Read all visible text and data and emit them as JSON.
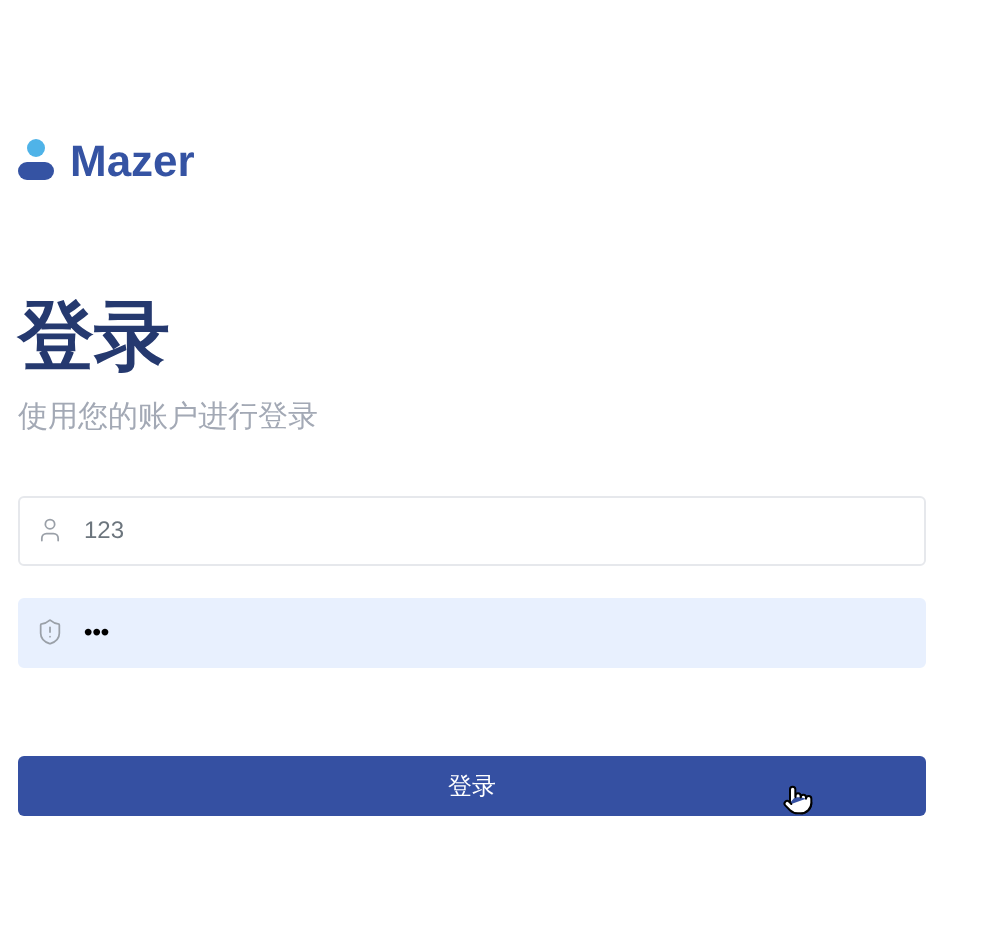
{
  "brand": {
    "name": "Mazer"
  },
  "title": "登录",
  "subtitle": "使用您的账户进行登录",
  "fields": [
    {
      "kind": "username",
      "value": "123",
      "autofilled": false
    },
    {
      "kind": "password",
      "value": "•••",
      "autofilled": true
    }
  ],
  "submit": {
    "label": "登录"
  }
}
